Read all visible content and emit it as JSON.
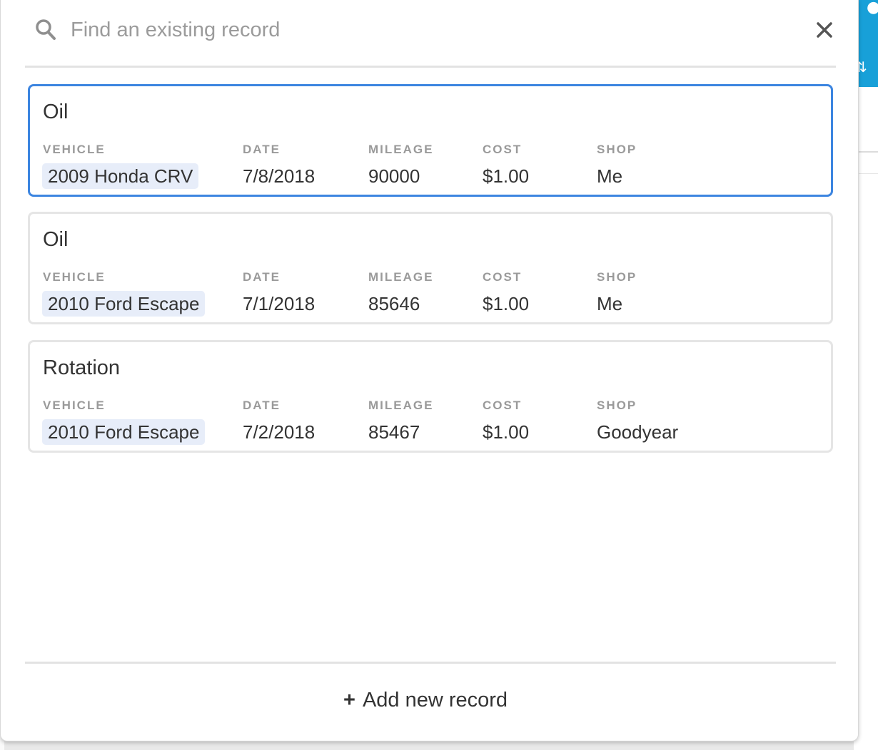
{
  "search": {
    "placeholder": "Find an existing record"
  },
  "icons": {
    "search": "search-icon",
    "close": "close-icon",
    "plus": "plus-icon"
  },
  "colors": {
    "selected_border": "#3c85e0",
    "chip_background": "#e7edf9",
    "accent_background": "#18a0d8"
  },
  "records": [
    {
      "title": "Oil",
      "selected": true,
      "vehicle_label": "VEHICLE",
      "vehicle": "2009 Honda CRV",
      "date_label": "DATE",
      "date": "7/8/2018",
      "mileage_label": "MILEAGE",
      "mileage": "90000",
      "cost_label": "COST",
      "cost": "$1.00",
      "shop_label": "SHOP",
      "shop": "Me"
    },
    {
      "title": "Oil",
      "selected": false,
      "vehicle_label": "VEHICLE",
      "vehicle": "2010 Ford Escape",
      "date_label": "DATE",
      "date": "7/1/2018",
      "mileage_label": "MILEAGE",
      "mileage": "85646",
      "cost_label": "COST",
      "cost": "$1.00",
      "shop_label": "SHOP",
      "shop": "Me"
    },
    {
      "title": "Rotation",
      "selected": false,
      "vehicle_label": "VEHICLE",
      "vehicle": "2010 Ford Escape",
      "date_label": "DATE",
      "date": "7/2/2018",
      "mileage_label": "MILEAGE",
      "mileage": "85467",
      "cost_label": "COST",
      "cost": "$1.00",
      "shop_label": "SHOP",
      "shop": "Goodyear"
    }
  ],
  "footer": {
    "plus": "+",
    "add_label": "Add new record"
  }
}
